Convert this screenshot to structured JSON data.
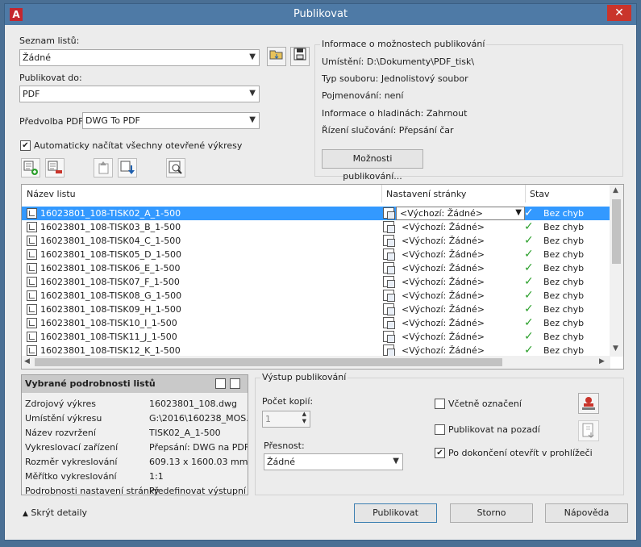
{
  "window": {
    "title": "Publikovat",
    "app_icon": "A",
    "close_label": "✕"
  },
  "sheet_list": {
    "label": "Seznam listů:",
    "value": "Žádné"
  },
  "publish_to": {
    "label": "Publikovat do:",
    "value": "PDF"
  },
  "pdf_preset": {
    "label": "Předvolba PDF:",
    "value": "DWG To PDF"
  },
  "auto_load": {
    "label": "Automaticky načítat všechny otevřené výkresy",
    "checked": true
  },
  "info": {
    "title": "Informace o možnostech publikování",
    "location": "Umístění: D:\\Dokumenty\\PDF_tisk\\",
    "file_type": "Typ souboru: Jednolistový soubor",
    "naming": "Pojmenování: není",
    "layer_info": "Informace o hladinách: Zahrnout",
    "merge": "Řízení slučování: Přepsání čar",
    "options_button": "Možnosti publikování..."
  },
  "list": {
    "headers": {
      "name": "Název listu",
      "page_setup": "Nastavení stránky",
      "status": "Stav"
    },
    "rows": [
      {
        "name": "16023801_108-TISK02_A_1-500",
        "page_setup": "<Výchozí: Žádné>",
        "status": "Bez chyb"
      },
      {
        "name": "16023801_108-TISK03_B_1-500",
        "page_setup": "<Výchozí: Žádné>",
        "status": "Bez chyb"
      },
      {
        "name": "16023801_108-TISK04_C_1-500",
        "page_setup": "<Výchozí: Žádné>",
        "status": "Bez chyb"
      },
      {
        "name": "16023801_108-TISK05_D_1-500",
        "page_setup": "<Výchozí: Žádné>",
        "status": "Bez chyb"
      },
      {
        "name": "16023801_108-TISK06_E_1-500",
        "page_setup": "<Výchozí: Žádné>",
        "status": "Bez chyb"
      },
      {
        "name": "16023801_108-TISK07_F_1-500",
        "page_setup": "<Výchozí: Žádné>",
        "status": "Bez chyb"
      },
      {
        "name": "16023801_108-TISK08_G_1-500",
        "page_setup": "<Výchozí: Žádné>",
        "status": "Bez chyb"
      },
      {
        "name": "16023801_108-TISK09_H_1-500",
        "page_setup": "<Výchozí: Žádné>",
        "status": "Bez chyb"
      },
      {
        "name": "16023801_108-TISK10_I_1-500",
        "page_setup": "<Výchozí: Žádné>",
        "status": "Bez chyb"
      },
      {
        "name": "16023801_108-TISK11_J_1-500",
        "page_setup": "<Výchozí: Žádné>",
        "status": "Bez chyb"
      },
      {
        "name": "16023801_108-TISK12_K_1-500",
        "page_setup": "<Výchozí: Žádné>",
        "status": "Bez chyb"
      }
    ]
  },
  "details": {
    "title": "Vybrané podrobnosti listů",
    "items": [
      {
        "key": "Zdrojový výkres",
        "value": "16023801_108.dwg"
      },
      {
        "key": "Umístění výkresu",
        "value": "G:\\2016\\160238_MOS..."
      },
      {
        "key": "Název rozvržení",
        "value": "TISK02_A_1-500"
      },
      {
        "key": "Vykreslovací zařízení",
        "value": "Přepsání: DWG na PDF"
      },
      {
        "key": "Rozměr vykreslování",
        "value": "609.13 x 1600.03 mm ..."
      },
      {
        "key": "Měřítko vykreslování",
        "value": "1:1"
      },
      {
        "key": "Podrobnosti nastavení stránky",
        "value": "Předefinovat výstupní ..."
      }
    ]
  },
  "output": {
    "title": "Výstup publikování",
    "copies_label": "Počet kopií:",
    "copies_value": "1",
    "precision_label": "Přesnost:",
    "precision_value": "Žádné",
    "include_stamp": {
      "label": "Včetně označení",
      "checked": false
    },
    "background": {
      "label": "Publikovat na pozadí",
      "checked": false
    },
    "open_viewer": {
      "label": "Po dokončení otevřít v prohlížeči",
      "checked": true
    }
  },
  "footer": {
    "hide_details": "Skrýt detaily",
    "publish": "Publikovat",
    "cancel": "Storno",
    "help": "Nápověda"
  },
  "colors": {
    "titlebar": "#4e7aa6",
    "selection": "#3399ff",
    "close": "#c9342b",
    "check": "#2ca02c"
  }
}
